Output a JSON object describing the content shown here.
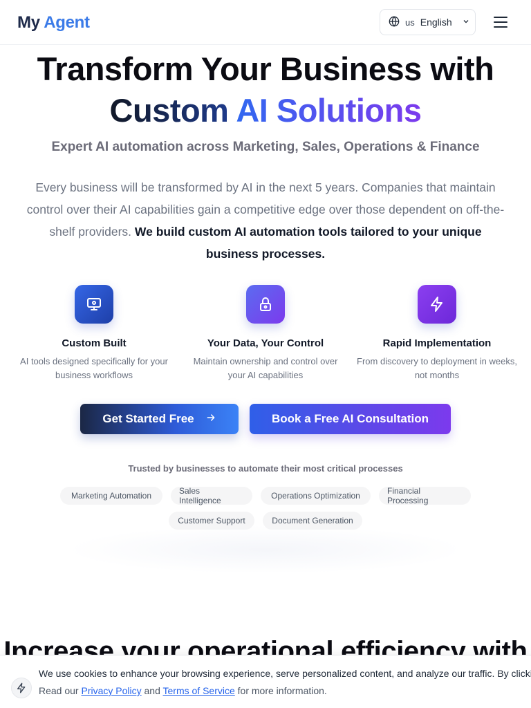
{
  "header": {
    "logo_part1": "My",
    "logo_part2": "Agent",
    "language_flag": "us",
    "language_label": "English",
    "globe_icon": "globe-icon",
    "menu_icon": "hamburger-menu-icon"
  },
  "hero": {
    "title_line1": "Transform Your Business with",
    "title_line2a": "Custom",
    "title_line2b": "AI Solutions",
    "subtitle": "Expert AI automation across Marketing, Sales, Operations & Finance",
    "intro_text": "Every business will be transformed by AI in the next 5 years. Companies that maintain control over their AI capabilities gain a competitive edge over those dependent on off-the-shelf providers.",
    "intro_bold": "We build custom AI automation tools tailored to your unique business processes."
  },
  "features": [
    {
      "icon": "monitor-icon",
      "title": "Custom Built",
      "description": "AI tools designed specifically for your business workflows"
    },
    {
      "icon": "lock-icon",
      "title": "Your Data, Your Control",
      "description": "Maintain ownership and control over your AI capabilities"
    },
    {
      "icon": "lightning-icon",
      "title": "Rapid Implementation",
      "description": "From discovery to deployment in weeks, not months"
    }
  ],
  "cta": {
    "primary_label": "Get Started Free",
    "primary_icon": "arrow-right-icon",
    "secondary_label": "Book a Free AI Consultation"
  },
  "trusted": {
    "heading": "Trusted by businesses to automate their most critical processes",
    "tags": [
      "Marketing Automation",
      "Sales Intelligence",
      "Operations Optimization",
      "Financial Processing",
      "Customer Support",
      "Document Generation"
    ]
  },
  "section": {
    "heading": "Increase your operational efficiency with"
  },
  "cookie": {
    "icon": "lightning-icon",
    "line1": "We use cookies to enhance your browsing experience, serve personalized content, and analyze our traffic. By clicking",
    "read_our": "Read our",
    "privacy_link": "Privacy Policy",
    "and": "and",
    "terms_link": "Terms of Service",
    "tail": "for more information."
  },
  "colors": {
    "brand_dark": "#1e2a4a",
    "brand_blue": "#3b7be8",
    "accent_purple": "#7c3aed",
    "link_blue": "#2563eb"
  }
}
